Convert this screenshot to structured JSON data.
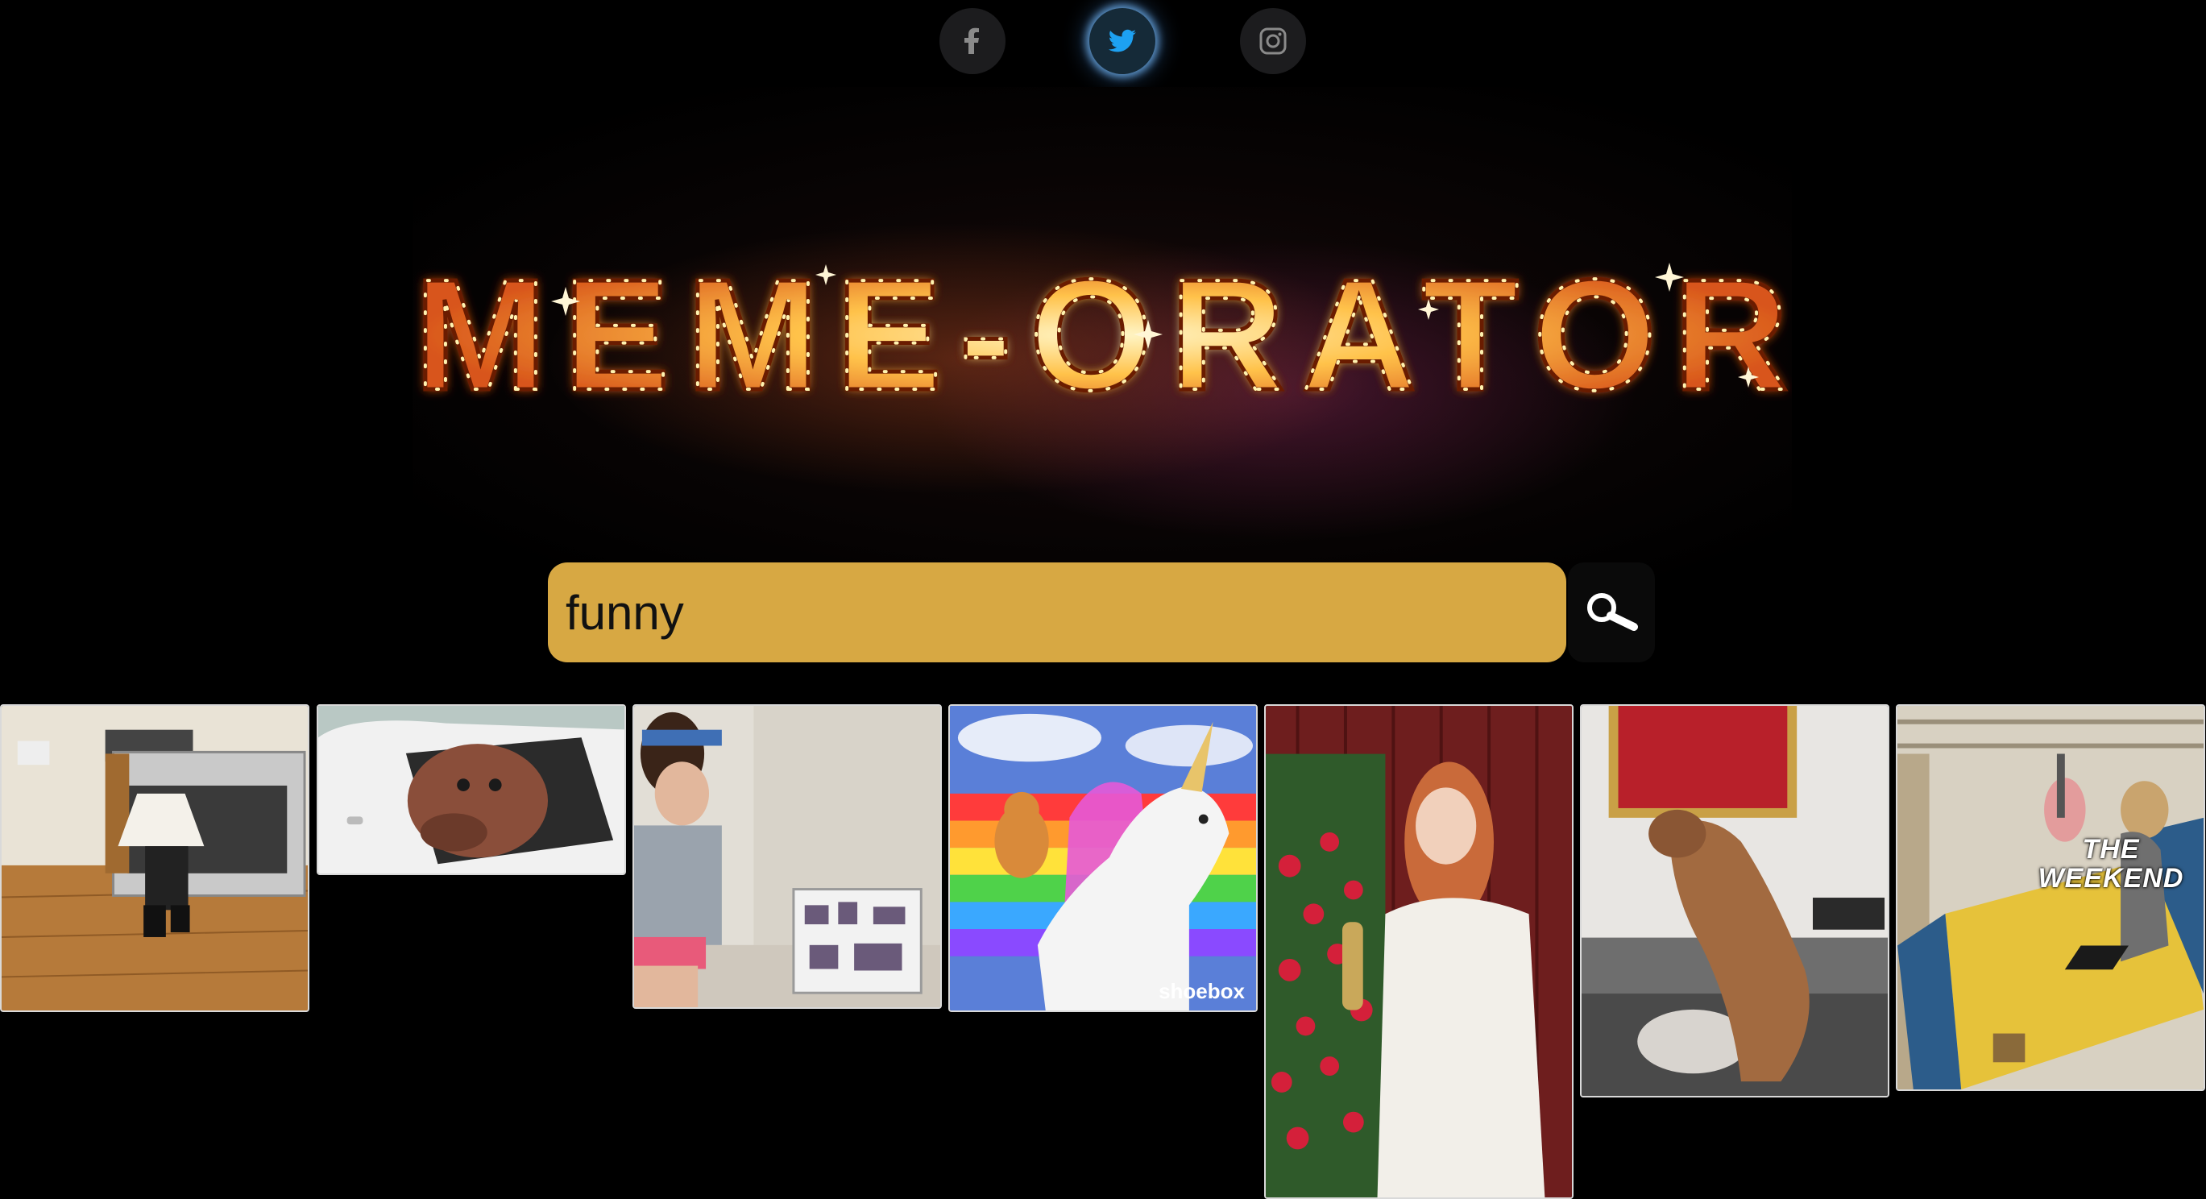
{
  "social": {
    "facebook_icon": "facebook-icon",
    "twitter_icon": "twitter-icon",
    "instagram_icon": "instagram-icon",
    "active": "twitter"
  },
  "banner": {
    "logo_text": "MEME-ORATOR"
  },
  "search": {
    "value": "funny",
    "button_icon": "search-icon",
    "accent_color": "#d7a843"
  },
  "results": [
    {
      "label": "lamp-head kid in kitchen gif"
    },
    {
      "label": "dog leaning out car window gif"
    },
    {
      "label": "girl dancing in room gif"
    },
    {
      "label": "cat riding unicorn on rainbow gif",
      "caption": "shoebox"
    },
    {
      "label": "woman with champagne bottle gif"
    },
    {
      "label": "person in bear costume gif"
    },
    {
      "label": "the weekend trampoline gif",
      "overlay_line1": "THE",
      "overlay_line2": "WEEKEND"
    }
  ]
}
